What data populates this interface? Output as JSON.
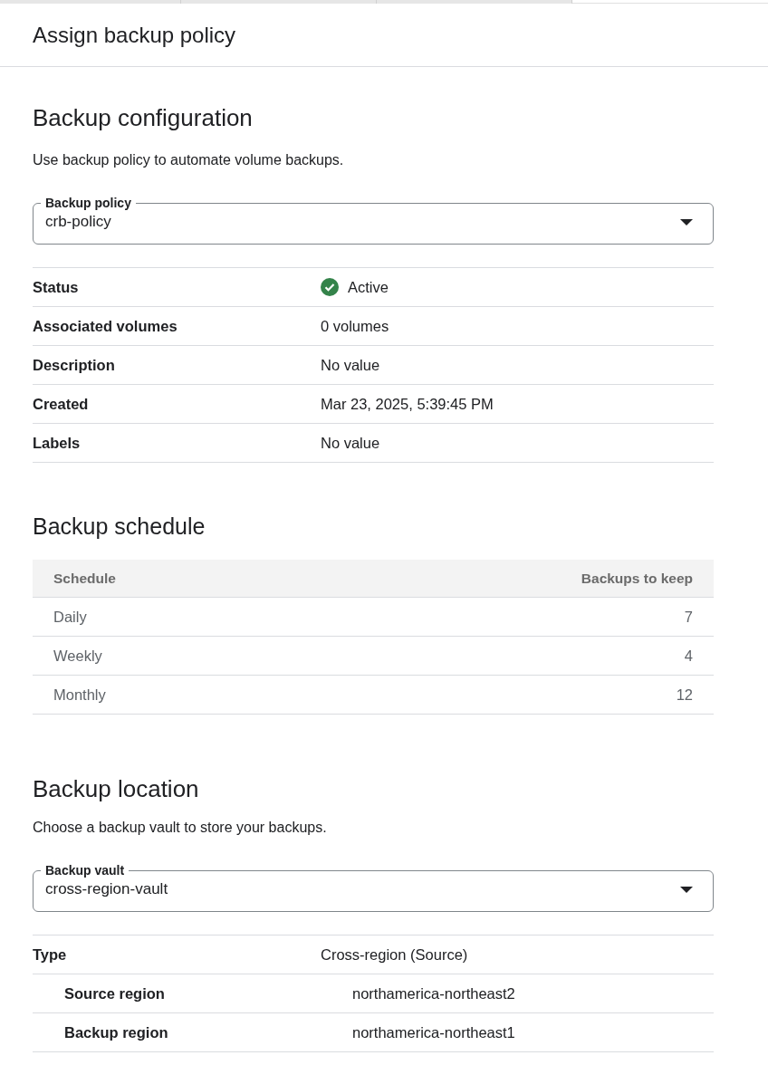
{
  "dialog": {
    "title": "Assign backup policy"
  },
  "backup_configuration": {
    "heading": "Backup configuration",
    "description": "Use backup policy to automate volume backups.",
    "policy_field": {
      "label": "Backup policy",
      "value": "crb-policy"
    },
    "details": [
      {
        "kind": "status",
        "label": "Status",
        "value": "Active"
      },
      {
        "kind": "text",
        "label": "Associated volumes",
        "value": "0 volumes"
      },
      {
        "kind": "text",
        "label": "Description",
        "value": "No value"
      },
      {
        "kind": "text",
        "label": "Created",
        "value": "Mar 23, 2025, 5:39:45 PM"
      },
      {
        "kind": "text",
        "label": "Labels",
        "value": "No value"
      }
    ]
  },
  "backup_schedule": {
    "heading": "Backup schedule",
    "columns": [
      "Schedule",
      "Backups to keep"
    ],
    "rows": [
      [
        "Daily",
        "7"
      ],
      [
        "Weekly",
        "4"
      ],
      [
        "Monthly",
        "12"
      ]
    ]
  },
  "backup_location": {
    "heading": "Backup location",
    "description": "Choose a backup vault to store your backups.",
    "vault_field": {
      "label": "Backup vault",
      "value": "cross-region-vault"
    },
    "details": [
      {
        "kind": "text",
        "label": "Type",
        "value": "Cross-region (Source)",
        "children": [
          {
            "kind": "text",
            "label": "Source region",
            "value": "northamerica-northeast2"
          },
          {
            "kind": "text",
            "label": "Backup region",
            "value": "northamerica-northeast1"
          }
        ]
      }
    ]
  }
}
